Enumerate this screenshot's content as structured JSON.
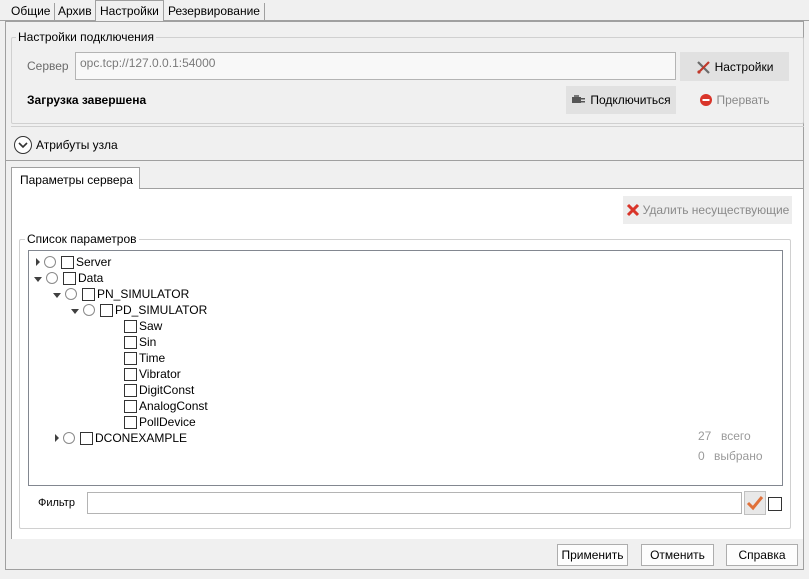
{
  "tabs": [
    {
      "label": "Общие",
      "active": false
    },
    {
      "label": "Архив",
      "active": false
    },
    {
      "label": "Настройки",
      "active": true
    },
    {
      "label": "Резервирование",
      "active": false
    }
  ],
  "connection": {
    "group_title": "Настройки подключения",
    "server_label": "Сервер",
    "server_value": "opc.tcp://127.0.0.1:54000",
    "settings_button": "Настройки",
    "status_text": "Загрузка завершена",
    "connect_button": "Подключиться",
    "abort_button": "Прервать"
  },
  "node_attributes": {
    "label": "Атрибуты узла"
  },
  "server_params": {
    "tab_label": "Параметры сервера",
    "delete_button": "Удалить несуществующие",
    "list_title": "Список параметров",
    "tree": [
      {
        "label": "Server",
        "expander": "collapsed"
      },
      {
        "label": "Data",
        "expander": "expanded"
      },
      {
        "label": "PN_SIMULATOR",
        "expander": "expanded"
      },
      {
        "label": "PD_SIMULATOR",
        "expander": "expanded"
      },
      {
        "label": "Saw",
        "expander": "none"
      },
      {
        "label": "Sin",
        "expander": "none"
      },
      {
        "label": "Time",
        "expander": "none"
      },
      {
        "label": "Vibrator",
        "expander": "none"
      },
      {
        "label": "DigitConst",
        "expander": "none"
      },
      {
        "label": "AnalogConst",
        "expander": "none"
      },
      {
        "label": "PollDevice",
        "expander": "none"
      },
      {
        "label": "DCONEXAMPLE",
        "expander": "collapsed"
      }
    ],
    "total_count": "27",
    "total_label": "всего",
    "selected_count": "0",
    "selected_label": "выбрано",
    "filter_label": "Фильтр",
    "filter_value": ""
  },
  "footer": {
    "apply_button": "Применить",
    "cancel_button": "Отменить",
    "help_button": "Справка"
  },
  "colors": {
    "accent_check": "#e0713a",
    "delete_icon": "#d9352a",
    "stop_icon": "#d9352a"
  }
}
